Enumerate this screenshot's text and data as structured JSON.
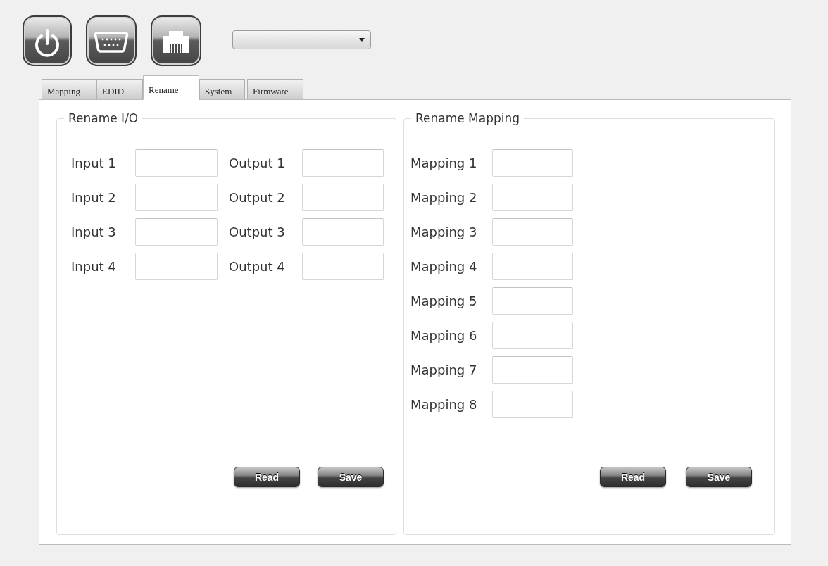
{
  "tabs": [
    {
      "label": "Mapping",
      "selected": false
    },
    {
      "label": "EDID",
      "selected": false
    },
    {
      "label": "Rename",
      "selected": true
    },
    {
      "label": "System",
      "selected": false
    },
    {
      "label": "Firmware",
      "selected": false
    }
  ],
  "rename_io": {
    "title": "Rename I/O",
    "inputs": [
      "Input 1",
      "Input 2",
      "Input 3",
      "Input 4"
    ],
    "outputs": [
      "Output 1",
      "Output 2",
      "Output 3",
      "Output 4"
    ],
    "read_button": "Read",
    "save_button": "Save"
  },
  "rename_mapping": {
    "title": "Rename Mapping",
    "mappings": [
      "Mapping 1",
      "Mapping 2",
      "Mapping 3",
      "Mapping 4",
      "Mapping 5",
      "Mapping 6",
      "Mapping 7",
      "Mapping 8"
    ],
    "read_button": "Read",
    "save_button": "Save"
  }
}
